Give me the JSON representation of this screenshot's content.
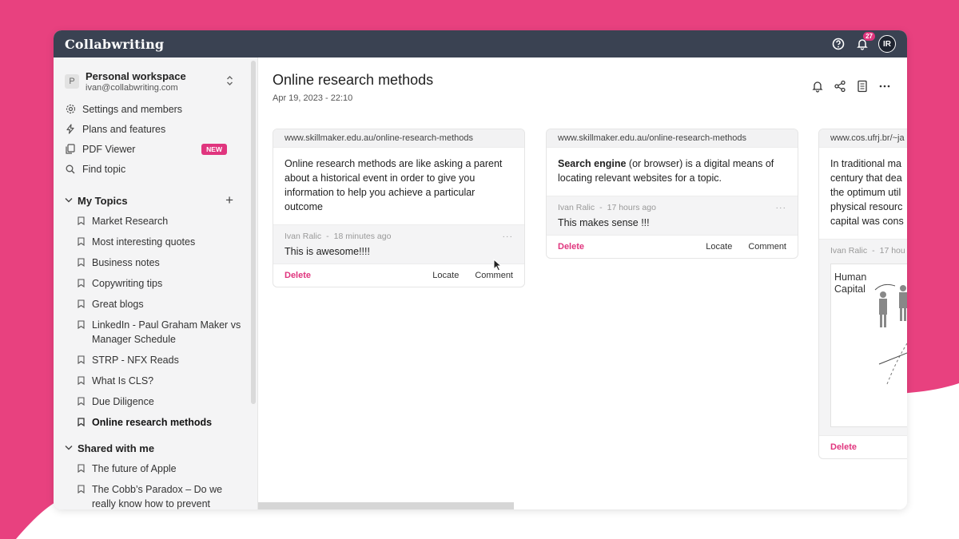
{
  "app": {
    "brand": "Collabwriting",
    "notifications_count": "27",
    "user_initials": "IR"
  },
  "workspace": {
    "initial": "P",
    "name": "Personal workspace",
    "email": "ivan@collabwriting.com"
  },
  "menu": [
    {
      "label": "Settings and members",
      "icon": "gear-icon"
    },
    {
      "label": "Plans and features",
      "icon": "bolt-icon"
    },
    {
      "label": "PDF Viewer",
      "icon": "pdf-icon",
      "badge": "NEW"
    },
    {
      "label": "Find topic",
      "icon": "search-icon"
    }
  ],
  "my_topics": {
    "title": "My Topics",
    "items": [
      "Market Research",
      "Most interesting quotes",
      "Business notes",
      "Copywriting tips",
      "Great blogs",
      "LinkedIn - Paul Graham Maker vs Manager Schedule",
      "STRP - NFX Reads",
      "What Is CLS?",
      "Due Diligence",
      "Online research methods"
    ]
  },
  "shared": {
    "title": "Shared with me",
    "items": [
      "The future of Apple",
      "The Cobb’s Paradox – Do we really know how to prevent"
    ]
  },
  "page": {
    "title": "Online research methods",
    "date": "Apr 19, 2023 - 22:10"
  },
  "cards": [
    {
      "url": "www.skillmaker.edu.au/online-research-methods",
      "text": "Online research methods are like asking a parent about a historical event in order to give you information to help you achieve a particular outcome",
      "comment_author": "Ivan Ralic",
      "comment_time": "18 minutes ago",
      "comment_text": "This is awesome!!!!",
      "delete": "Delete",
      "locate": "Locate",
      "comment": "Comment"
    },
    {
      "url": "www.skillmaker.edu.au/online-research-methods",
      "text_bold": "Search engine",
      "text": " (or browser) is a digital means of locating relevant websites for a topic.",
      "comment_author": "Ivan Ralic",
      "comment_time": "17 hours ago",
      "comment_text": "This makes sense !!!",
      "delete": "Delete",
      "locate": "Locate",
      "comment": "Comment"
    },
    {
      "url": "www.cos.ufrj.br/~ja",
      "text": "In traditional ma century that dea the optimum util physical resourc capital was cons",
      "comment_author": "Ivan Ralic",
      "comment_time": "17 hou",
      "image_label_1": "Human",
      "image_label_2": "Capital",
      "delete": "Delete"
    }
  ],
  "colors": {
    "accent": "#e0357e",
    "topbar": "#3a4252",
    "background_pink": "#e8417f"
  }
}
